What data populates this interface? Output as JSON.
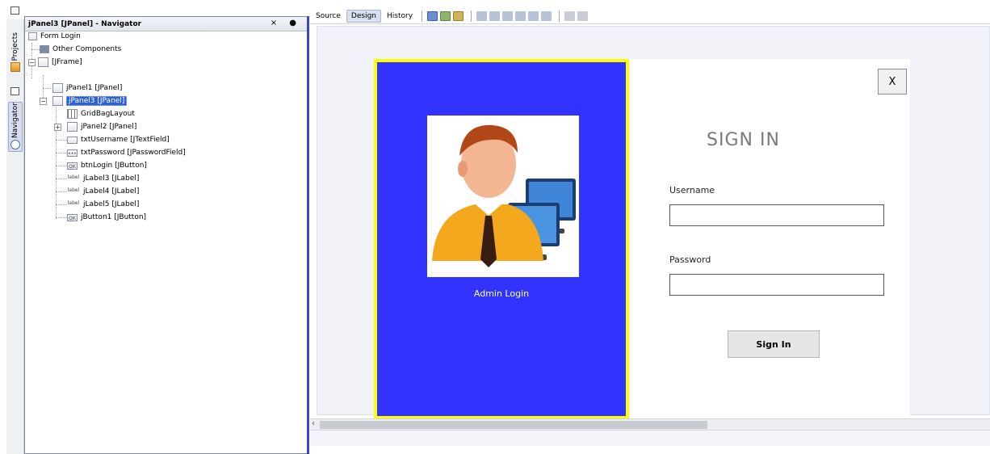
{
  "navigator": {
    "title": "jPanel3 [JPanel] - Navigator",
    "controls": "× ●",
    "tree": {
      "form_login": "Form Login",
      "other_components": "Other Components",
      "jframe": "[JFrame]",
      "jpanel1": "jPanel1 [JPanel]",
      "jpanel3": "jPanel3 [JPanel]",
      "gridbag": "GridBagLayout",
      "jpanel2": "jPanel2 [JPanel]",
      "txt_username": "txtUsername [JTextField]",
      "txt_password": "txtPassword [JPasswordField]",
      "btn_login": "btnLogin [JButton]",
      "jlabel3": "jLabel3 [JLabel]",
      "jlabel4": "jLabel4 [JLabel]",
      "jlabel5": "jLabel5 [JLabel]",
      "jbutton1": "jButton1 [JButton]",
      "icon_label": "label",
      "icon_ok": "OK"
    }
  },
  "side_tabs": {
    "projects": "Projects",
    "navigator": "Navigator"
  },
  "editor": {
    "tabs": [
      "Source",
      "Design",
      "History"
    ],
    "active_tab": "Design"
  },
  "form": {
    "admin_label": "Admin Login",
    "close_label": "X",
    "title": "SIGN IN",
    "username_label": "Username",
    "password_label": "Password",
    "signin_label": "Sign In"
  },
  "colors": {
    "panel_blue": "#3333ff",
    "panel_border": "#ffff00",
    "selection": "#2f61d6"
  }
}
